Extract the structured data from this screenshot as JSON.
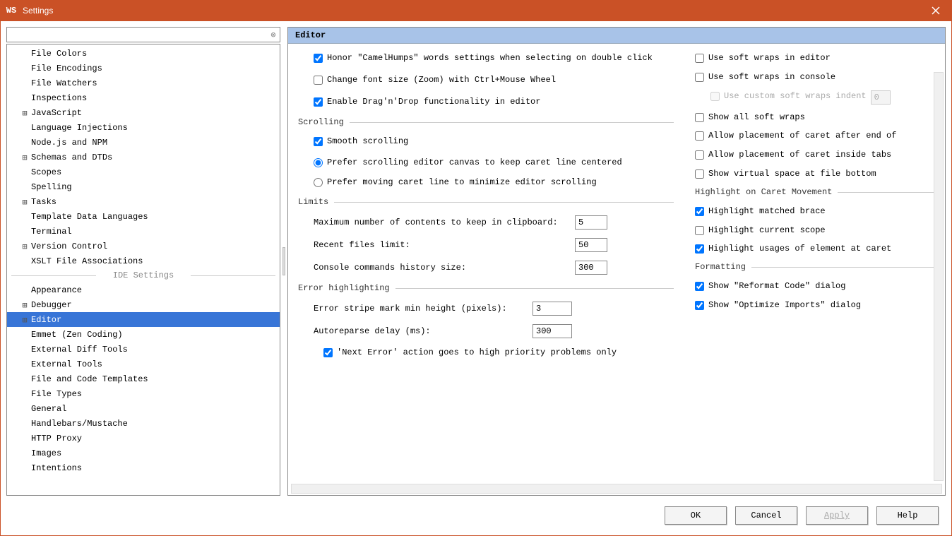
{
  "window": {
    "title": "Settings",
    "logo_text": "WS"
  },
  "search": {
    "value": "",
    "placeholder": ""
  },
  "sidebar": {
    "items": [
      {
        "label": "File Colors",
        "indent": 1,
        "expander": ""
      },
      {
        "label": "File Encodings",
        "indent": 1,
        "expander": ""
      },
      {
        "label": "File Watchers",
        "indent": 1,
        "expander": ""
      },
      {
        "label": "Inspections",
        "indent": 1,
        "expander": ""
      },
      {
        "label": "JavaScript",
        "indent": 1,
        "expander": "⊞"
      },
      {
        "label": "Language Injections",
        "indent": 1,
        "expander": ""
      },
      {
        "label": "Node.js and NPM",
        "indent": 1,
        "expander": ""
      },
      {
        "label": "Schemas and DTDs",
        "indent": 1,
        "expander": "⊞"
      },
      {
        "label": "Scopes",
        "indent": 1,
        "expander": ""
      },
      {
        "label": "Spelling",
        "indent": 1,
        "expander": ""
      },
      {
        "label": "Tasks",
        "indent": 1,
        "expander": "⊞"
      },
      {
        "label": "Template Data Languages",
        "indent": 1,
        "expander": ""
      },
      {
        "label": "Terminal",
        "indent": 1,
        "expander": ""
      },
      {
        "label": "Version Control",
        "indent": 1,
        "expander": "⊞"
      },
      {
        "label": "XSLT File Associations",
        "indent": 1,
        "expander": ""
      }
    ],
    "section": "IDE Settings",
    "ide_items": [
      {
        "label": "Appearance",
        "indent": 1,
        "expander": ""
      },
      {
        "label": "Debugger",
        "indent": 1,
        "expander": "⊞"
      },
      {
        "label": "Editor",
        "indent": 1,
        "expander": "⊞",
        "selected": true
      },
      {
        "label": "Emmet (Zen Coding)",
        "indent": 1,
        "expander": ""
      },
      {
        "label": "External Diff Tools",
        "indent": 1,
        "expander": ""
      },
      {
        "label": "External Tools",
        "indent": 1,
        "expander": ""
      },
      {
        "label": "File and Code Templates",
        "indent": 1,
        "expander": ""
      },
      {
        "label": "File Types",
        "indent": 1,
        "expander": ""
      },
      {
        "label": "General",
        "indent": 1,
        "expander": ""
      },
      {
        "label": "Handlebars/Mustache",
        "indent": 1,
        "expander": ""
      },
      {
        "label": "HTTP Proxy",
        "indent": 1,
        "expander": ""
      },
      {
        "label": "Images",
        "indent": 1,
        "expander": ""
      },
      {
        "label": "Intentions",
        "indent": 1,
        "expander": ""
      }
    ]
  },
  "panel": {
    "title": "Editor",
    "left": {
      "honor_camel": {
        "label": "Honor \"CamelHumps\" words settings when selecting on double click",
        "checked": true
      },
      "change_font": {
        "label": "Change font size (Zoom) with Ctrl+Mouse Wheel",
        "checked": false
      },
      "enable_dnd": {
        "label": "Enable Drag'n'Drop functionality in editor",
        "checked": true
      },
      "scrolling": {
        "title": "Scrolling",
        "smooth": {
          "label": "Smooth scrolling",
          "checked": true
        },
        "radio1": {
          "label": "Prefer scrolling editor canvas to keep caret line centered",
          "selected": true
        },
        "radio2": {
          "label": "Prefer moving caret line to minimize editor scrolling",
          "selected": false
        }
      },
      "limits": {
        "title": "Limits",
        "clipboard": {
          "label": "Maximum number of contents to keep in clipboard:",
          "value": "5"
        },
        "recent": {
          "label": "Recent files limit:",
          "value": "50"
        },
        "console": {
          "label": "Console commands history size:",
          "value": "300"
        }
      },
      "error": {
        "title": "Error highlighting",
        "stripe": {
          "label": "Error stripe mark min height (pixels):",
          "value": "3"
        },
        "autoreparse": {
          "label": "Autoreparse delay (ms):",
          "value": "300"
        },
        "next_error": {
          "label": "'Next Error' action goes to high priority problems only",
          "checked": true
        }
      }
    },
    "right": {
      "soft_editor": {
        "label": "Use soft wraps in editor",
        "checked": false
      },
      "soft_console": {
        "label": "Use soft wraps in console",
        "checked": false
      },
      "custom_indent": {
        "label": "Use custom soft wraps indent",
        "checked": false,
        "value": "0"
      },
      "show_all": {
        "label": "Show all soft wraps",
        "checked": false
      },
      "caret_eol": {
        "label": "Allow placement of caret after end of",
        "checked": false
      },
      "caret_tabs": {
        "label": "Allow placement of caret inside tabs",
        "checked": false
      },
      "virtual_bottom": {
        "label": "Show virtual space at file bottom",
        "checked": false
      },
      "highlight": {
        "title": "Highlight on Caret Movement",
        "brace": {
          "label": "Highlight matched brace",
          "checked": true
        },
        "scope": {
          "label": "Highlight current scope",
          "checked": false
        },
        "usages": {
          "label": "Highlight usages of element at caret",
          "checked": true
        }
      },
      "formatting": {
        "title": "Formatting",
        "reformat": {
          "label": "Show \"Reformat Code\" dialog",
          "checked": true
        },
        "optimize": {
          "label": "Show \"Optimize Imports\" dialog",
          "checked": true
        }
      }
    }
  },
  "buttons": {
    "ok": "OK",
    "cancel": "Cancel",
    "apply": "Apply",
    "help": "Help"
  }
}
